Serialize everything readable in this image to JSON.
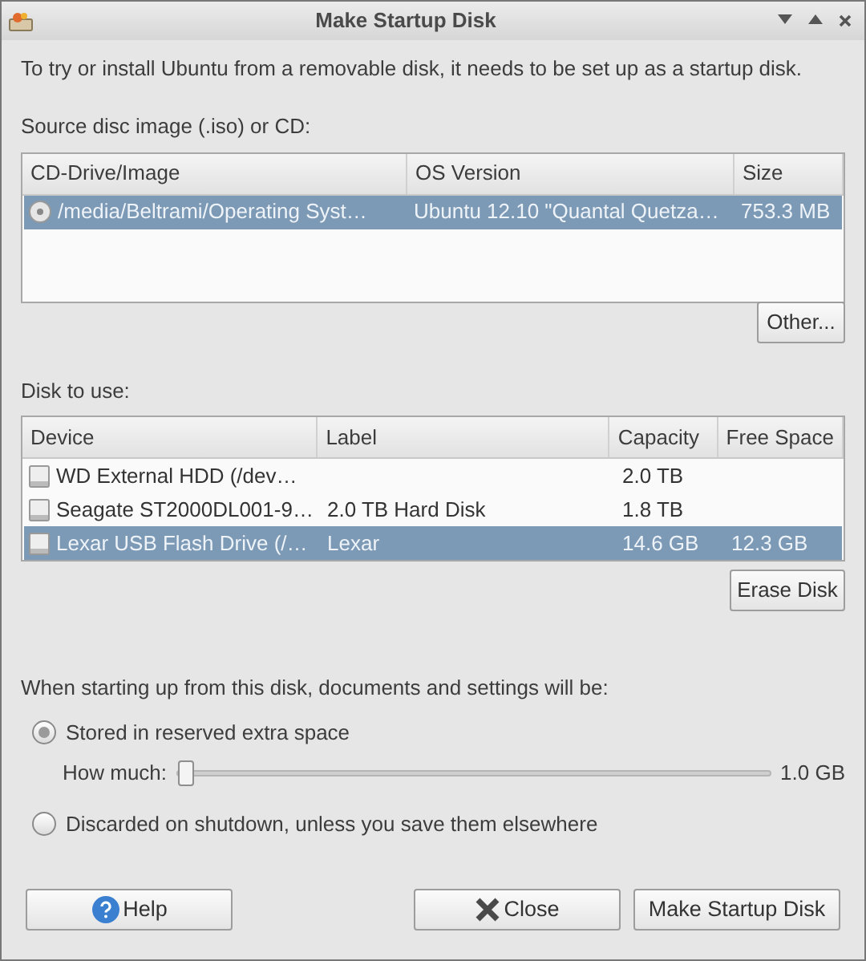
{
  "window": {
    "title": "Make Startup Disk"
  },
  "intro": "To try or install Ubuntu from a removable disk, it needs to be set up as a startup disk.",
  "source": {
    "label": "Source disc image (.iso) or CD:",
    "columns": [
      "CD-Drive/Image",
      "OS Version",
      "Size"
    ],
    "rows": [
      {
        "cells": [
          "/media/Beltrami/Operating Syst…",
          "Ubuntu 12.10 \"Quantal Quetza…",
          "753.3 MB"
        ],
        "selected": true
      }
    ],
    "button": "Other..."
  },
  "disk": {
    "label": "Disk to use:",
    "columns": [
      "Device",
      "Label",
      "Capacity",
      "Free Space"
    ],
    "rows": [
      {
        "cells": [
          "WD External HDD (/dev…",
          "",
          "2.0 TB",
          ""
        ],
        "selected": false
      },
      {
        "cells": [
          "Seagate ST2000DL001-9…",
          "2.0 TB Hard Disk",
          "1.8 TB",
          ""
        ],
        "selected": false
      },
      {
        "cells": [
          "Lexar USB Flash Drive (/…",
          "Lexar",
          "14.6 GB",
          "12.3 GB"
        ],
        "selected": true
      }
    ],
    "button": "Erase Disk"
  },
  "persistence": {
    "label": "When starting up from this disk, documents and settings will be:",
    "options": [
      {
        "label": "Stored in reserved extra space",
        "selected": true
      },
      {
        "label": "Discarded on shutdown, unless you save them elsewhere",
        "selected": false
      }
    ],
    "slider": {
      "label": "How much:",
      "level": 0,
      "reading": "1.0 GB"
    }
  },
  "buttons": [
    {
      "label": "Help",
      "kind": "help"
    },
    {
      "label": "Close",
      "kind": "close"
    },
    {
      "label": "Make Startup Disk",
      "kind": "plain"
    }
  ]
}
